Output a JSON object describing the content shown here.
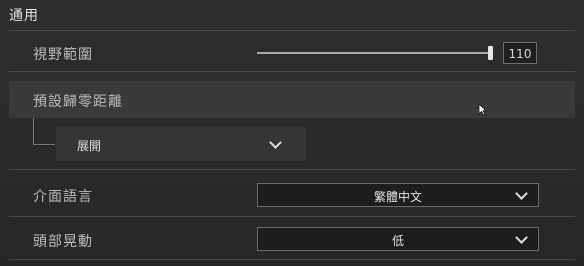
{
  "section": {
    "title": "通用"
  },
  "fov": {
    "label": "視野範圍",
    "value": "110",
    "slider_level": 0.995
  },
  "preset_zero": {
    "label": "預設歸零距離",
    "dropdown_value": "展開"
  },
  "language": {
    "label": "介面語言",
    "value": "繁體中文"
  },
  "head_bob": {
    "label": "頭部晃動",
    "value": "低"
  },
  "icons": {
    "chevron": "chevron-down-icon",
    "cursor": "mouse-cursor-icon"
  }
}
